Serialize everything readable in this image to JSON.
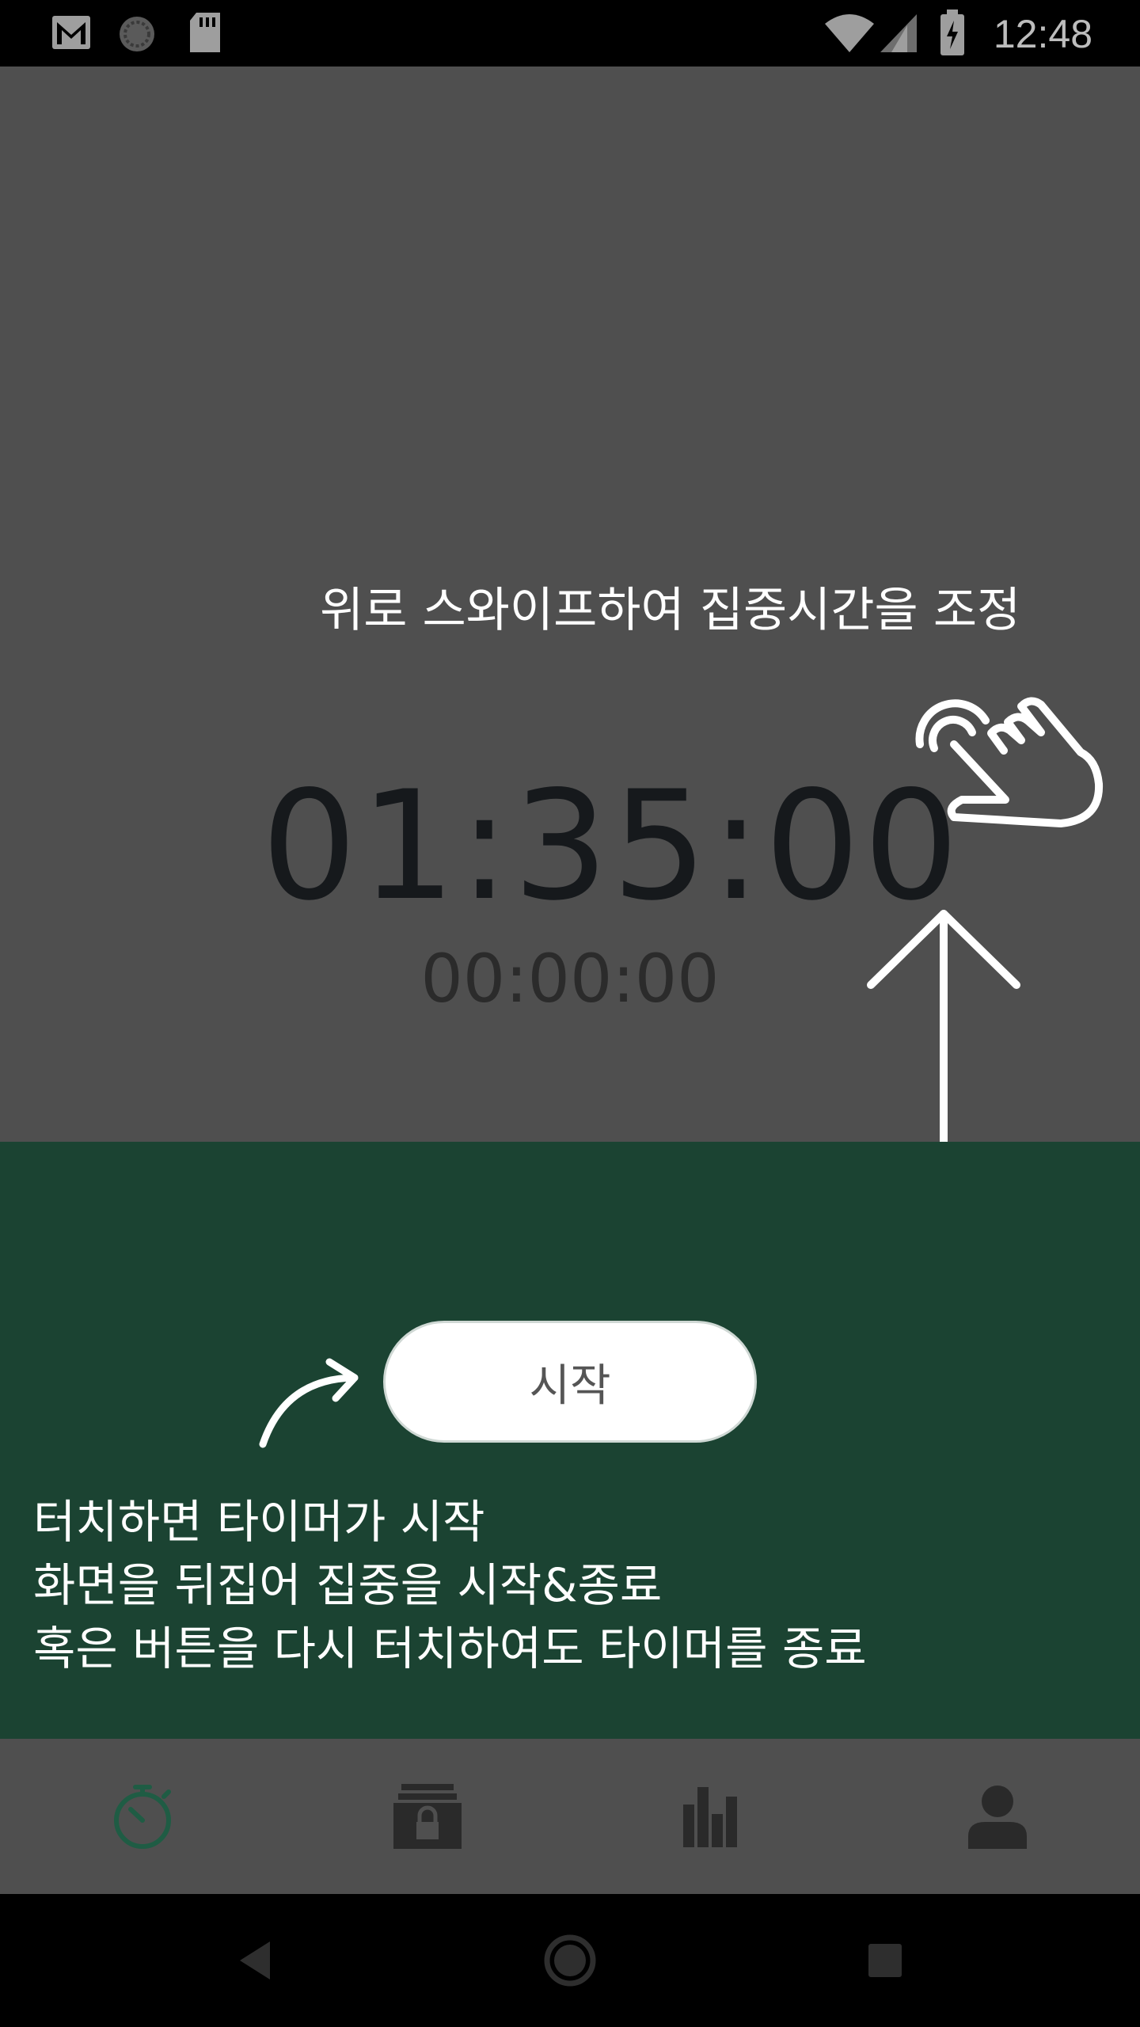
{
  "status_bar": {
    "time": "12:48",
    "icons": [
      "gmail-icon",
      "sync-icon",
      "sd-card-icon",
      "wifi-icon",
      "cell-signal-icon",
      "battery-charging-icon"
    ]
  },
  "timer": {
    "swipe_hint": "위로 스와이프하여 집중시간을 조정",
    "main_time": "01:35:00",
    "elapsed_time": "00:00:00"
  },
  "start_panel": {
    "start_button_label": "시작",
    "hint_lines": [
      "터치하면 타이머가 시작",
      "화면을 뒤집어 집중을 시작&종료",
      "혹은 버튼을 다시 터치하여도 타이머를 종료"
    ]
  },
  "bottom_nav": {
    "items": [
      "stopwatch-icon",
      "lock-box-icon",
      "bar-chart-icon",
      "profile-icon"
    ],
    "active_color": "#1f5c44",
    "inactive_color": "#2a2a2a"
  },
  "system_nav": [
    "back-icon",
    "home-icon",
    "recents-icon"
  ],
  "colors": {
    "overlay_gray": "#4f4f4f",
    "panel_green": "#1b4332"
  }
}
